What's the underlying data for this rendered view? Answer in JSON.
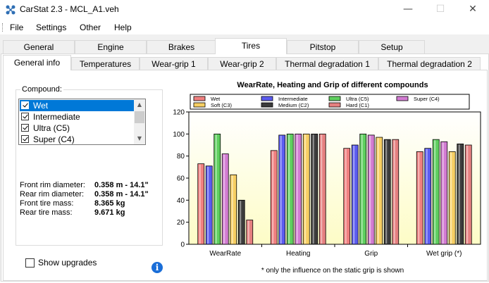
{
  "window": {
    "title": "CarStat 2.3 - MCL_A1.veh",
    "minimize_glyph": "—",
    "maximize_glyph": "☐",
    "close_glyph": "✕"
  },
  "menu": {
    "items": [
      "File",
      "Settings",
      "Other",
      "Help"
    ]
  },
  "main_tabs": [
    "General",
    "Engine",
    "Brakes",
    "Tires",
    "Pitstop",
    "Setup"
  ],
  "main_tab_active": "Tires",
  "sub_tabs": [
    "General info",
    "Temperatures",
    "Wear-grip 1",
    "Wear-grip 2",
    "Thermal degradation 1",
    "Thermal degradation 2"
  ],
  "sub_tab_active": "General info",
  "compound": {
    "label": "Compound:",
    "items": [
      {
        "label": "Wet",
        "checked": true,
        "selected": true
      },
      {
        "label": "Intermediate",
        "checked": true,
        "selected": false
      },
      {
        "label": "Ultra (C5)",
        "checked": true,
        "selected": false
      },
      {
        "label": "Super (C4)",
        "checked": true,
        "selected": false
      }
    ]
  },
  "tire_info": {
    "front_rim_label": "Front rim diameter:",
    "front_rim_value": "0.358 m - 14.1\"",
    "rear_rim_label": "Rear rim diameter:",
    "rear_rim_value": "0.358 m - 14.1\"",
    "front_mass_label": "Front tire mass:",
    "front_mass_value": "8.365 kg",
    "rear_mass_label": "Rear tire mass:",
    "rear_mass_value": "9.671 kg"
  },
  "show_upgrades": {
    "label": "Show upgrades",
    "checked": false
  },
  "info_icon_glyph": "i",
  "chart_data": {
    "type": "bar",
    "title": "WearRate, Heating and Grip of different compounds",
    "footnote": "* only the influence on the static grip is shown",
    "categories": [
      "WearRate",
      "Heating",
      "Grip",
      "Wet grip (*)"
    ],
    "ylim": [
      0,
      120
    ],
    "yticks": [
      0,
      20,
      40,
      60,
      80,
      100,
      120
    ],
    "grid": false,
    "legend_placement": "top",
    "series": [
      {
        "name": "Wet",
        "color": "#f08080",
        "values": [
          73,
          85,
          87,
          84
        ]
      },
      {
        "name": "Intermediate",
        "color": "#5b5bef",
        "values": [
          71,
          99,
          90,
          87
        ]
      },
      {
        "name": "Ultra (C5)",
        "color": "#5fcf5f",
        "values": [
          100,
          100,
          100,
          95
        ]
      },
      {
        "name": "Super (C4)",
        "color": "#d27bd2",
        "values": [
          82,
          100,
          99,
          93
        ]
      },
      {
        "name": "Soft (C3)",
        "color": "#f7cf63",
        "values": [
          63,
          100,
          97,
          84
        ]
      },
      {
        "name": "Medium (C2)",
        "color": "#3c3c3c",
        "values": [
          40,
          100,
          95,
          91
        ]
      },
      {
        "name": "Hard (C1)",
        "color": "#e58080",
        "values": [
          22,
          100,
          95,
          90
        ]
      }
    ]
  }
}
